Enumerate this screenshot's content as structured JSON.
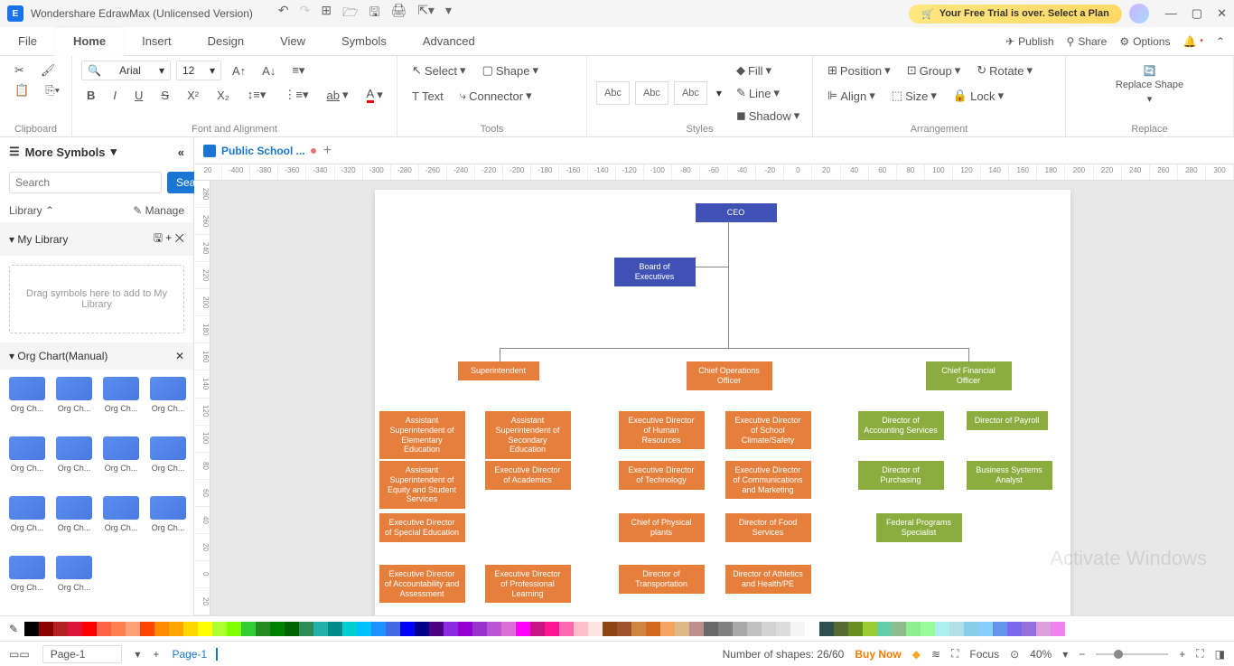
{
  "app": {
    "title": "Wondershare EdrawMax (Unlicensed Version)",
    "logo": "E"
  },
  "trial": {
    "text": "Your Free Trial is over. Select a Plan",
    "icon": "🛒"
  },
  "menubar": {
    "tabs": [
      "File",
      "Home",
      "Insert",
      "Design",
      "View",
      "Symbols",
      "Advanced"
    ],
    "active": 1,
    "right": {
      "publish": "Publish",
      "share": "Share",
      "options": "Options"
    }
  },
  "ribbon": {
    "groups": {
      "clipboard": "Clipboard",
      "font": "Font and Alignment",
      "tools": "Tools",
      "styles": "Styles",
      "arrangement": "Arrangement",
      "replace": "Replace"
    },
    "font": {
      "name": "Arial",
      "size": "12"
    },
    "select": "Select",
    "shape": "Shape",
    "text": "Text",
    "connector": "Connector",
    "abc": "Abc",
    "fill": "Fill",
    "line": "Line",
    "shadow": "Shadow",
    "position": "Position",
    "group": "Group",
    "rotate": "Rotate",
    "align": "Align",
    "size_btn": "Size",
    "lock": "Lock",
    "replace_shape": "Replace Shape"
  },
  "panel": {
    "more_symbols": "More Symbols",
    "search_btn": "Search",
    "search_ph": "Search",
    "library": "Library",
    "manage": "Manage",
    "my_library": "My Library",
    "drop_hint": "Drag symbols here to add to My Library",
    "org_chart": "Org Chart(Manual)",
    "shape_label": "Org Ch..."
  },
  "doc": {
    "tab_name": "Public School ...",
    "add": "+"
  },
  "ruler_h": [
    "20",
    "-400",
    "-380",
    "-360",
    "-340",
    "-320",
    "-300",
    "-280",
    "-260",
    "-240",
    "-220",
    "-200",
    "-180",
    "-160",
    "-140",
    "-120",
    "-100",
    "-80",
    "-60",
    "-40",
    "-20",
    "0",
    "20",
    "40",
    "60",
    "80",
    "100",
    "120",
    "140",
    "160",
    "180",
    "200",
    "220",
    "240",
    "260",
    "280",
    "300"
  ],
  "ruler_v": [
    "280",
    "260",
    "240",
    "220",
    "200",
    "180",
    "160",
    "140",
    "120",
    "100",
    "80",
    "60",
    "40",
    "20",
    "0",
    "20"
  ],
  "org": {
    "ceo": "CEO",
    "board": "Board of Executives",
    "super": "Superintendent",
    "coo": "Chief Operations Officer",
    "cfo": "Chief Financial Officer",
    "l1": [
      "Assistant Superintendent of Elementary Education",
      "Assistant Superintendent of Secondary Education"
    ],
    "l2": [
      "Assistant Superintendent of Equity and Student Services",
      "Executive Director of Academics"
    ],
    "l3": [
      "Executive Director of Special Education"
    ],
    "l4": [
      "Executive Director of Accountability and Assessment",
      "Executive Director of Professional Learning"
    ],
    "m1": [
      "Executive Director of Human Resources",
      "Executive Director of School Climate/Safety"
    ],
    "m2": [
      "Executive Director of Technology",
      "Executive Director of Communications and Marketing"
    ],
    "m3": [
      "Chief of Physical plants",
      "Director of Food Services"
    ],
    "m4": [
      "Director of Transportation",
      "Director of Athletics and Health/PE"
    ],
    "r1": [
      "Director of Accounting Services",
      "Director of Payroll"
    ],
    "r2": [
      "Director of Purchasing",
      "Business Systems Analyst"
    ],
    "r3": [
      "Federal Programs Specialist"
    ]
  },
  "status": {
    "page_sel": "Page-1",
    "page_tab": "Page-1",
    "shapes": "Number of shapes: 26/60",
    "buy": "Buy Now",
    "focus": "Focus",
    "zoom": "40%"
  },
  "watermark": "Activate Windows",
  "colors": [
    "#000",
    "#8b0000",
    "#b22222",
    "#dc143c",
    "#ff0000",
    "#ff6347",
    "#ff7f50",
    "#ffa07a",
    "#ff4500",
    "#ff8c00",
    "#ffa500",
    "#ffd700",
    "#ffff00",
    "#adff2f",
    "#7fff00",
    "#32cd32",
    "#228b22",
    "#008000",
    "#006400",
    "#2e8b57",
    "#20b2aa",
    "#008b8b",
    "#00ced1",
    "#00bfff",
    "#1e90ff",
    "#4169e1",
    "#0000ff",
    "#00008b",
    "#4b0082",
    "#8a2be2",
    "#9400d3",
    "#9932cc",
    "#ba55d3",
    "#da70d6",
    "#ff00ff",
    "#c71585",
    "#ff1493",
    "#ff69b4",
    "#ffc0cb",
    "#ffe4e1",
    "#8b4513",
    "#a0522d",
    "#cd853f",
    "#d2691e",
    "#f4a460",
    "#deb887",
    "#bc8f8f",
    "#696969",
    "#808080",
    "#a9a9a9",
    "#c0c0c0",
    "#d3d3d3",
    "#dcdcdc",
    "#f5f5f5",
    "#fff",
    "#2f4f4f",
    "#556b2f",
    "#6b8e23",
    "#9acd32",
    "#66cdaa",
    "#8fbc8f",
    "#90ee90",
    "#98fb98",
    "#afeeee",
    "#b0e0e6",
    "#87ceeb",
    "#87cefa",
    "#6495ed",
    "#7b68ee",
    "#9370db",
    "#dda0dd",
    "#ee82ee"
  ]
}
